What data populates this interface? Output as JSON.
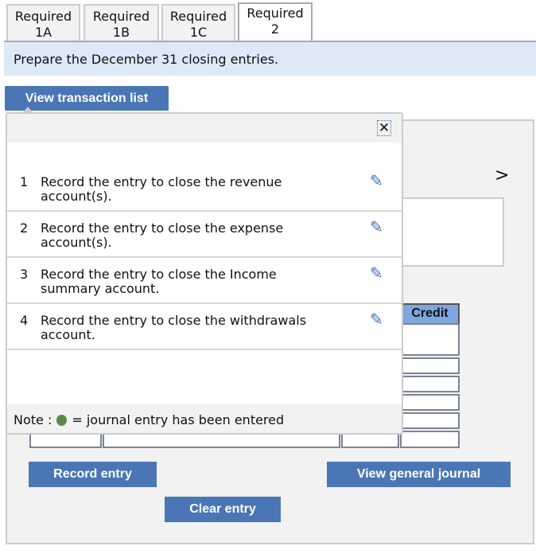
{
  "tabs": [
    {
      "label": "Required 1A",
      "line1": "Required",
      "line2": "1A"
    },
    {
      "label": "Required 1B",
      "line1": "Required",
      "line2": "1B"
    },
    {
      "label": "Required 1C",
      "line1": "Required",
      "line2": "1C"
    },
    {
      "label": "Required 2",
      "line1": "Required",
      "line2": "2",
      "active": true
    }
  ],
  "instruction": "Prepare the December 31 closing entries.",
  "view_transaction_list": "View transaction list",
  "popup": {
    "close_icon": "close-icon",
    "items": [
      {
        "num": "1",
        "text": "Record the entry to close the revenue account(s)."
      },
      {
        "num": "2",
        "text": "Record the entry to close the expense account(s)."
      },
      {
        "num": "3",
        "text": "Record the entry to close the Income summary account."
      },
      {
        "num": "4",
        "text": "Record the entry to close the withdrawals account."
      }
    ],
    "note_prefix": "Note :",
    "note_suffix": "= journal entry has been entered",
    "note_dot_color": "#5a8a4a"
  },
  "journal": {
    "credit_header": "Credit",
    "next_icon": ">"
  },
  "buttons": {
    "record": "Record entry",
    "view_journal": "View general journal",
    "clear": "Clear entry"
  },
  "colors": {
    "accent": "#4a76b5",
    "header_blue": "#7ea6e0",
    "banner": "#dde9f7"
  }
}
